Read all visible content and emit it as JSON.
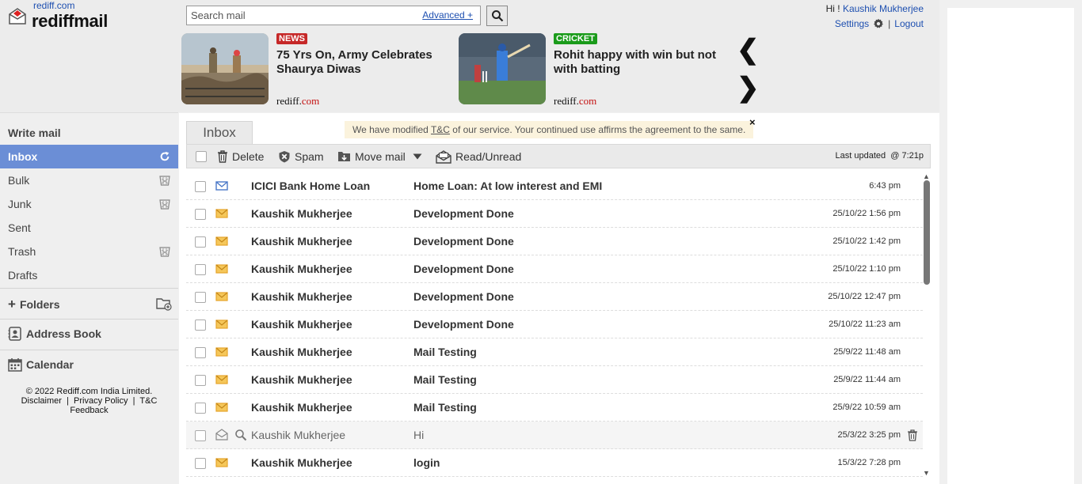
{
  "header": {
    "site_link": "rediff.com",
    "logo_text": "rediffmail",
    "search": {
      "placeholder": "Search mail",
      "advanced_label": "Advanced +"
    },
    "user": {
      "greeting": "Hi !",
      "name": "Kaushik Mukherjee",
      "settings_label": "Settings",
      "logout_label": "Logout"
    },
    "news": [
      {
        "tag": "NEWS",
        "tag_color": "#c62828",
        "title": "75 Yrs On, Army Celebrates Shaurya Diwas",
        "source_main": "rediff.",
        "source_suffix": "com"
      },
      {
        "tag": "CRICKET",
        "tag_color": "#1a9b1a",
        "title": "Rohit happy with win but not with batting",
        "source_main": "rediff.",
        "source_suffix": "com"
      }
    ],
    "prev_arrow": "❮",
    "next_arrow": "❯"
  },
  "sidebar": {
    "write_mail": "Write mail",
    "folders": [
      {
        "label": "Inbox",
        "active": true
      },
      {
        "label": "Bulk",
        "has_trash": true
      },
      {
        "label": "Junk",
        "has_trash": true
      },
      {
        "label": "Sent"
      },
      {
        "label": "Trash",
        "has_trash": true
      },
      {
        "label": "Drafts"
      }
    ],
    "folders_label": "Folders",
    "address_book_label": "Address Book",
    "calendar_label": "Calendar",
    "footer": {
      "copyright": "© 2022 Rediff.com India Limited.",
      "disclaimer": "Disclaimer",
      "privacy": "Privacy Policy",
      "tc": "T&C",
      "feedback": "Feedback"
    }
  },
  "main": {
    "tab_label": "Inbox",
    "notice_before": "We have modified ",
    "notice_link": "T&C",
    "notice_after": " of our service. Your continued use affirms the agreement to the same.",
    "notice_close": "×",
    "toolbar": {
      "delete_label": "Delete",
      "spam_label": "Spam",
      "move_label": "Move mail",
      "read_unread_label": "Read/Unread",
      "last_updated_label": "Last updated",
      "last_updated_time": "@ 7:21p"
    },
    "mails": [
      {
        "from": "ICICI Bank Home Loan",
        "subject": "Home Loan: At low interest and EMI",
        "date": "6:43 pm",
        "icon": "blue-envelope",
        "read": false
      },
      {
        "from": "Kaushik Mukherjee",
        "subject": "Development Done",
        "date": "25/10/22 1:56 pm",
        "icon": "yellow-envelope",
        "read": false
      },
      {
        "from": "Kaushik Mukherjee",
        "subject": "Development Done",
        "date": "25/10/22 1:42 pm",
        "icon": "yellow-envelope",
        "read": false
      },
      {
        "from": "Kaushik Mukherjee",
        "subject": "Development Done",
        "date": "25/10/22 1:10 pm",
        "icon": "yellow-envelope",
        "read": false
      },
      {
        "from": "Kaushik Mukherjee",
        "subject": "Development Done",
        "date": "25/10/22 12:47 pm",
        "icon": "yellow-envelope",
        "read": false
      },
      {
        "from": "Kaushik Mukherjee",
        "subject": "Development Done",
        "date": "25/10/22 11:23 am",
        "icon": "yellow-envelope",
        "read": false
      },
      {
        "from": "Kaushik Mukherjee",
        "subject": "Mail Testing",
        "date": "25/9/22 11:48 am",
        "icon": "yellow-envelope",
        "read": false
      },
      {
        "from": "Kaushik Mukherjee",
        "subject": "Mail Testing",
        "date": "25/9/22 11:44 am",
        "icon": "yellow-envelope",
        "read": false
      },
      {
        "from": "Kaushik Mukherjee",
        "subject": "Mail Testing",
        "date": "25/9/22 10:59 am",
        "icon": "yellow-envelope",
        "read": false
      },
      {
        "from": "Kaushik Mukherjee",
        "subject": "Hi",
        "date": "25/3/22 3:25 pm",
        "icon": "open-envelope",
        "read": true
      },
      {
        "from": "Kaushik Mukherjee",
        "subject": "login",
        "date": "15/3/22 7:28 pm",
        "icon": "yellow-envelope",
        "read": false
      }
    ]
  },
  "colors": {
    "accent_blue": "#6b8ed6",
    "link_blue": "#1d4fb0",
    "notice_bg": "#fbf3dd",
    "envelope_yellow": "#f0b040"
  }
}
